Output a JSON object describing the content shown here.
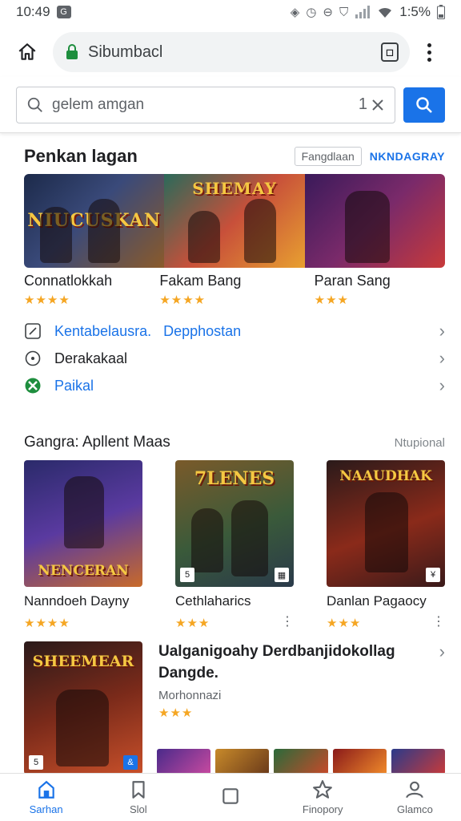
{
  "status_bar": {
    "time": "10:49",
    "battery": "1:5%"
  },
  "toolbar": {
    "url": "Sibumbacl"
  },
  "search": {
    "value": "gelem amgan",
    "count": "1"
  },
  "section1": {
    "title": "Penkan lagan",
    "filter_label": "Fangdlaan",
    "more_link": "NKNDAGRAY",
    "banner_logos": [
      "NIUCUSKAN",
      "SHEMAY"
    ],
    "games": [
      {
        "name": "Connatlokkah",
        "stars": "★★★★"
      },
      {
        "name": "Fakam Bang",
        "stars": "★★★★"
      },
      {
        "name": "Paran Sang",
        "stars": "★★★"
      }
    ],
    "links": [
      {
        "label": "Kentabelausra.",
        "label2": "Depphostan",
        "icon": "edit-icon"
      },
      {
        "label": "Derakakaal",
        "icon": "clock-icon"
      },
      {
        "label": "Paikal",
        "icon": "pinwheel-icon"
      }
    ]
  },
  "section2": {
    "title": "Gangra: Apllent Maas",
    "more": "Ntupional",
    "cards": [
      {
        "name": "Nanndoeh Dayny",
        "stars": "★★★★",
        "logo": "NENCERAN"
      },
      {
        "name": "Cethlaharics",
        "stars": "★★★",
        "logo": "7LENES"
      },
      {
        "name": "Danlan Pagaocy",
        "stars": "★★★",
        "logo": "NAAUDHAK"
      }
    ],
    "feature": {
      "title": "Ualganigoahy Derdbanjidokollag Dangde.",
      "subtitle": "Morhonnazi",
      "stars": "★★★",
      "logo": "SHEEMEAR"
    }
  },
  "bottom_nav": [
    {
      "label": "Sarhan",
      "icon": "home-icon"
    },
    {
      "label": "Slol",
      "icon": "bookmark-icon"
    },
    {
      "label": "",
      "icon": "tabs-icon"
    },
    {
      "label": "Finopory",
      "icon": "star-icon"
    },
    {
      "label": "Glamco",
      "icon": "person-icon"
    }
  ],
  "colors": {
    "accent": "#1a73e8",
    "star": "#f5a623",
    "lock": "#1e8e3e"
  }
}
